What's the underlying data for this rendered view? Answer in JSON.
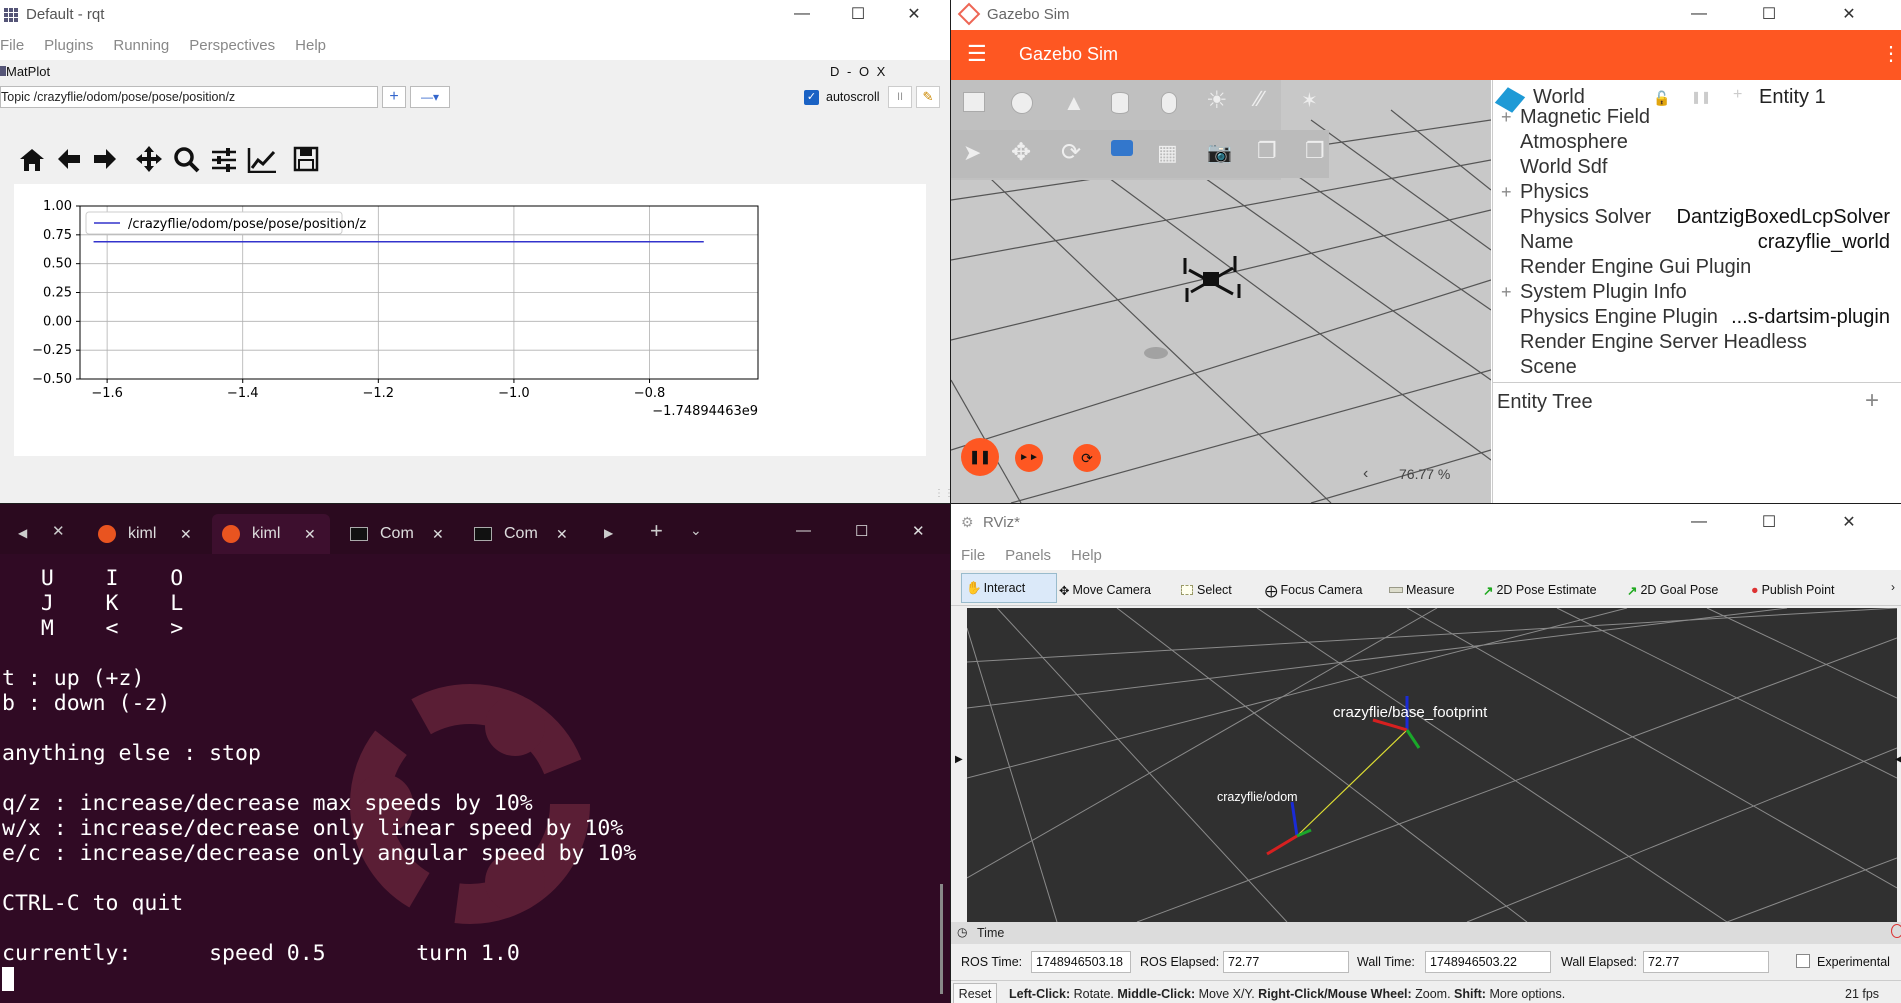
{
  "rqt": {
    "title": "Default - rqt",
    "menu": [
      "File",
      "Plugins",
      "Running",
      "Perspectives",
      "Help"
    ],
    "plugin_title": "MatPlot",
    "plugin_controls": "D - O X",
    "topic_label": "Topic",
    "topic_value": "/crazyflie/odom/pose/pose/position/z",
    "autoscroll_label": "autoscroll",
    "toolbar_icons": [
      "home-icon",
      "back-arrow-icon",
      "forward-arrow-icon",
      "pan-icon",
      "zoom-icon",
      "configure-subplots-icon",
      "edit-axis-icon",
      "save-icon"
    ]
  },
  "chart_data": {
    "type": "line",
    "series": [
      {
        "name": "/crazyflie/odom/pose/pose/position/z",
        "x": [
          -1.62,
          -0.72
        ],
        "y": [
          0.69,
          0.69
        ],
        "color": "#3333cc"
      }
    ],
    "yticks": [
      "1.00",
      "0.75",
      "0.50",
      "0.25",
      "0.00",
      "−0.25",
      "−0.50"
    ],
    "xticks": [
      "−1.6",
      "−1.4",
      "−1.2",
      "−1.0",
      "−0.8"
    ],
    "x_offset_label": "−1.74894463e9",
    "ylim": [
      -0.5,
      1.0
    ],
    "xlim": [
      -1.64,
      -0.64
    ],
    "grid": true,
    "legend": "top-left"
  },
  "gazebo": {
    "title": "Gazebo Sim",
    "header_title": "Gazebo Sim",
    "world_label": "World",
    "entity_label": "Entity 1",
    "properties": [
      {
        "k": "Magnetic Field",
        "v": "",
        "plus": true
      },
      {
        "k": "Atmosphere",
        "v": "",
        "plus": false
      },
      {
        "k": "World Sdf",
        "v": "",
        "plus": false
      },
      {
        "k": "Physics",
        "v": "",
        "plus": true
      },
      {
        "k": "Physics Solver",
        "v": "DantzigBoxedLcpSolver",
        "plus": false
      },
      {
        "k": "Name",
        "v": "crazyflie_world",
        "plus": false
      },
      {
        "k": "Render Engine Gui Plugin",
        "v": "",
        "plus": false
      },
      {
        "k": "System Plugin Info",
        "v": "",
        "plus": true
      },
      {
        "k": "Physics Engine Plugin",
        "v": "...s-dartsim-plugin",
        "plus": false
      },
      {
        "k": "Render Engine Server Headless",
        "v": "",
        "plus": false
      },
      {
        "k": "Scene",
        "v": "",
        "plus": false
      }
    ],
    "entity_tree_label": "Entity Tree",
    "rtf": "76.77 %",
    "accent": "#fe5722"
  },
  "terminal": {
    "tabs": [
      {
        "label": "kiml",
        "icon": "ubuntu-icon",
        "active": false
      },
      {
        "label": "kiml",
        "icon": "ubuntu-icon",
        "active": true
      },
      {
        "label": "Com",
        "icon": "terminal-icon",
        "active": false
      },
      {
        "label": "Com",
        "icon": "terminal-icon",
        "active": false
      }
    ],
    "lines": [
      "   U    I    O",
      "   J    K    L",
      "   M    <    >",
      "",
      "t : up (+z)",
      "b : down (-z)",
      "",
      "anything else : stop",
      "",
      "q/z : increase/decrease max speeds by 10%",
      "w/x : increase/decrease only linear speed by 10%",
      "e/c : increase/decrease only angular speed by 10%",
      "",
      "CTRL-C to quit",
      "",
      "currently:      speed 0.5       turn 1.0"
    ]
  },
  "rviz": {
    "title": "RViz*",
    "menu": [
      "File",
      "Panels",
      "Help"
    ],
    "tools": [
      "Interact",
      "Move Camera",
      "Select",
      "Focus Camera",
      "Measure",
      "2D Pose Estimate",
      "2D Goal Pose",
      "Publish Point"
    ],
    "frame_labels": [
      "crazyflie/base_footprint",
      "crazyflie/odom"
    ],
    "time_panel_title": "Time",
    "ros_time_label": "ROS Time:",
    "ros_time": "1748946503.18",
    "ros_elapsed_label": "ROS Elapsed:",
    "ros_elapsed": "72.77",
    "wall_time_label": "Wall Time:",
    "wall_time": "1748946503.22",
    "wall_elapsed_label": "Wall Elapsed:",
    "wall_elapsed": "72.77",
    "experimental_label": "Experimental",
    "reset_label": "Reset",
    "hint_b1": "Left-Click:",
    "hint_t1": " Rotate. ",
    "hint_b2": "Middle-Click:",
    "hint_t2": " Move X/Y. ",
    "hint_b3": "Right-Click/Mouse Wheel:",
    "hint_t3": " Zoom. ",
    "hint_b4": "Shift:",
    "hint_t4": " More options.",
    "fps": "21 fps"
  }
}
